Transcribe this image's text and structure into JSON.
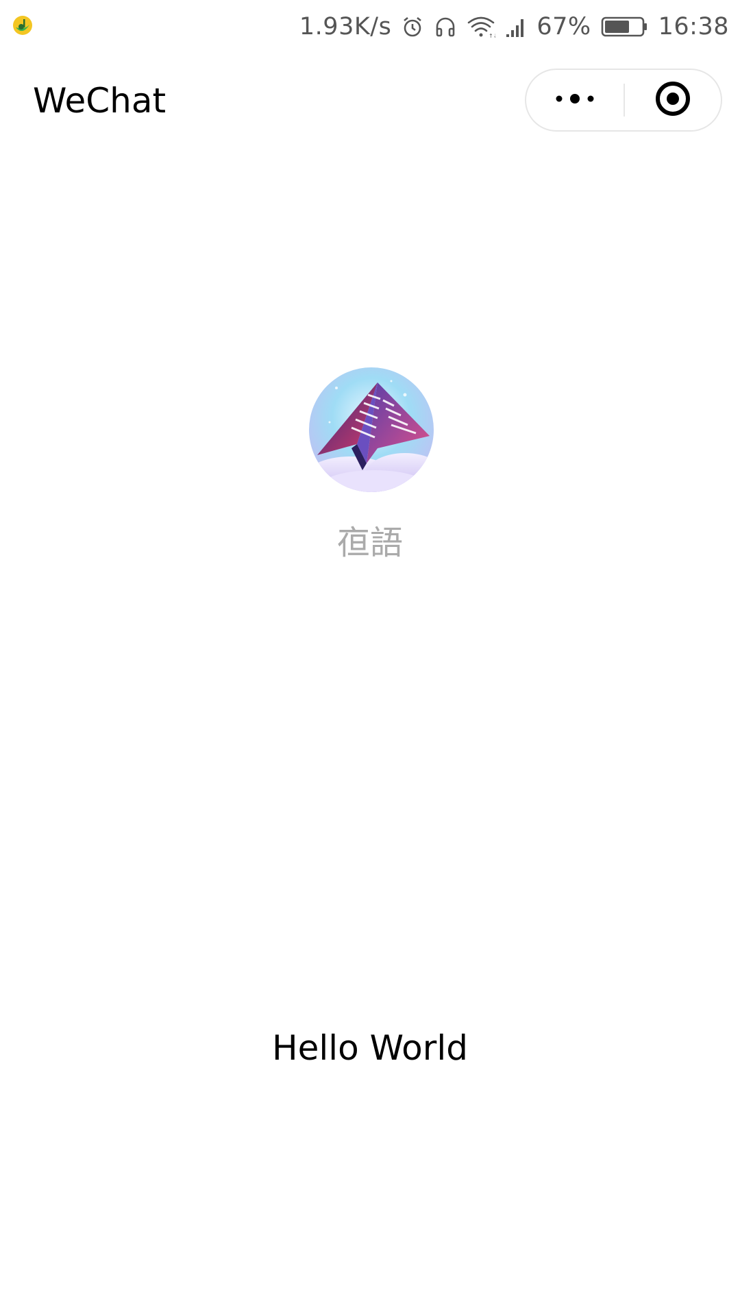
{
  "status_bar": {
    "network_speed": "1.93K/s",
    "battery_percent": "67%",
    "time": "16:38",
    "icons": [
      "music-app-icon",
      "alarm-icon",
      "headphones-icon",
      "wifi-icon",
      "signal-icon",
      "battery-icon"
    ],
    "battery_level": 0.67
  },
  "nav": {
    "title": "WeChat",
    "more_icon": "more-dots-icon",
    "close_icon": "target-circle-icon"
  },
  "user": {
    "nickname": "亱語",
    "avatar_icon": "avatar-image"
  },
  "motto": "Hello World",
  "colors": {
    "background": "#ffffff",
    "nickname": "#aaaaaa",
    "capsule_border": "#e6e6e6",
    "status_text": "#555555"
  }
}
